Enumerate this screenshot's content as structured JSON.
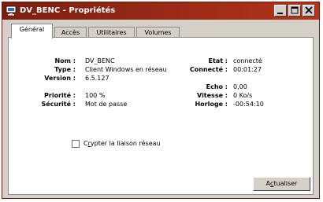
{
  "window": {
    "title": "DV_BENC - Propriétés"
  },
  "tabs": [
    "Général",
    "Accès",
    "Utilitaires",
    "Volumes"
  ],
  "left_info": {
    "nom": {
      "label": "Nom :",
      "value": "DV_BENC"
    },
    "type": {
      "label": "Type :",
      "value": "Client Windows en réseau"
    },
    "version": {
      "label": "Version :",
      "value": "6.5.127"
    },
    "priorite": {
      "label": "Priorité :",
      "value": "100 %"
    },
    "securite": {
      "label": "Sécurité :",
      "value": "Mot de passe"
    }
  },
  "right_info": {
    "etat": {
      "label": "Etat :",
      "value": "connecté"
    },
    "connecte": {
      "label": "Connecté :",
      "value": "00:01:27"
    },
    "echo": {
      "label": "Echo :",
      "value": "0,00"
    },
    "vitesse": {
      "label": "Vitesse :",
      "value": "0 Ko/s"
    },
    "horloge": {
      "label": "Horloge :",
      "value": "-00:54:10"
    }
  },
  "crypt_checkbox": {
    "label_prefix": "C",
    "label_accel": "r",
    "label_rest": "ypter la liaison réseau",
    "checked": false
  },
  "actions": {
    "update_prefix": "A",
    "update_accel": "c",
    "update_rest": "tualiser"
  }
}
